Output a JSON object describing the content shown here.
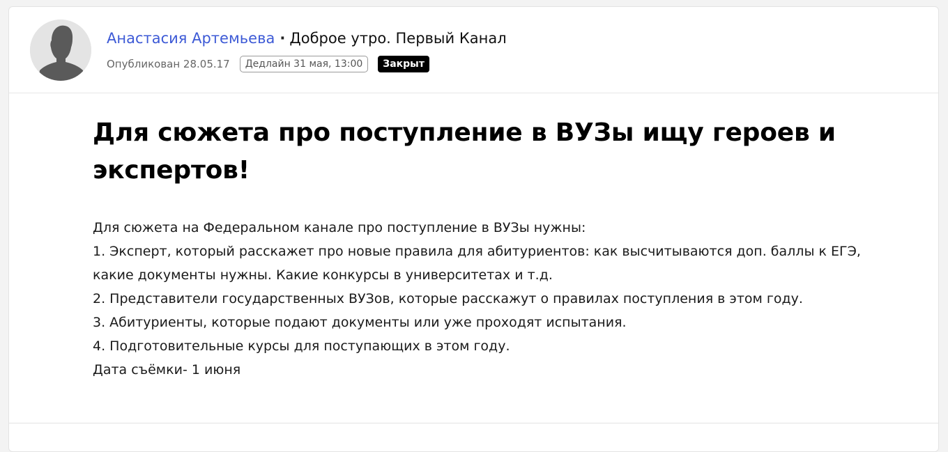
{
  "author": {
    "name": "Анастасия Артемьева",
    "separator": "·",
    "outlet": "Доброе утро. Первый Канал"
  },
  "meta": {
    "published": "Опубликован 28.05.17",
    "deadline": "Дедлайн 31 мая, 13:00",
    "status": "Закрыт"
  },
  "post": {
    "title": "Для сюжета про поступление в ВУЗы ищу героев и экспертов!",
    "body": [
      "Для сюжета на Федеральном канале про поступление в ВУЗы нужны:",
      "1. Эксперт, который расскажет про новые правила для абитуриентов: как высчитываются доп. баллы к ЕГЭ, какие документы нужны. Какие конкурсы в университетах и т.д.",
      "2. Представители государственных ВУЗов, которые расскажут о правилах поступления в этом году.",
      "3. Абитуриенты, которые подают документы или уже проходят испытания.",
      "4. Подготовительные курсы для поступающих в этом году.",
      "Дата съёмки- 1 июня"
    ]
  },
  "colors": {
    "author_link": "#3d5ad6",
    "status_badge_bg": "#000000",
    "avatar_bg": "#e4e4e4",
    "avatar_silhouette": "#5a5a5a"
  },
  "icons": {
    "avatar": "default-user-silhouette-icon"
  }
}
